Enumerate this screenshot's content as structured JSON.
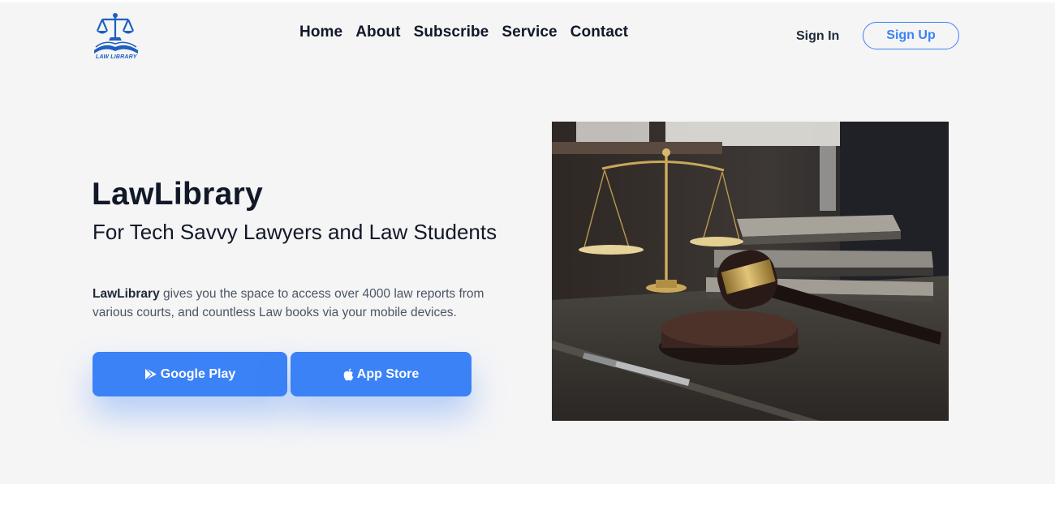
{
  "brand": {
    "logo_text": "LAW LIBRARY"
  },
  "nav": {
    "items": [
      "Home",
      "About",
      "Subscribe",
      "Service",
      "Contact"
    ]
  },
  "auth": {
    "sign_in": "Sign In",
    "sign_up": "Sign Up"
  },
  "hero": {
    "title": "LawLibrary",
    "subtitle": "For Tech Savvy Lawyers and Law Students",
    "description_brand": "LawLibrary",
    "description_rest": " gives you the space to access over 4000 law reports from various courts, and countless Law books via your mobile devices.",
    "buttons": {
      "google_play": "Google Play",
      "app_store": "App Store"
    },
    "image_icons": [
      "scales-of-justice",
      "gavel",
      "books",
      "pen"
    ]
  },
  "colors": {
    "accent": "#3b82f6",
    "hero_bg": "#f5f5f6",
    "logo_blue": "#1e5fc0",
    "text_dark": "#111827"
  }
}
